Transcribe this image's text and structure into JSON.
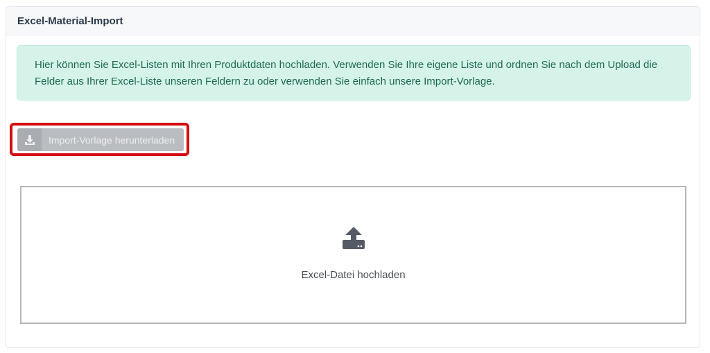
{
  "card": {
    "title": "Excel-Material-Import"
  },
  "info_alert": {
    "text": "Hier können Sie Excel-Listen mit Ihren Produktdaten hochladen. Verwenden Sie Ihre eigene Liste und ordnen Sie nach dem Upload die Felder aus Ihrer Excel-Liste unseren Feldern zu oder verwenden Sie einfach unsere Import-Vorlage."
  },
  "template_button": {
    "label": "Import-Vorlage herunterladen",
    "icon": "download-icon"
  },
  "dropzone": {
    "label": "Excel-Datei hochladen",
    "icon": "upload-icon"
  },
  "colors": {
    "highlight": "#d40a10",
    "alert_bg": "#d6f3e9",
    "alert_text": "#1b6b4c",
    "button_bg": "#b9bcc0"
  }
}
